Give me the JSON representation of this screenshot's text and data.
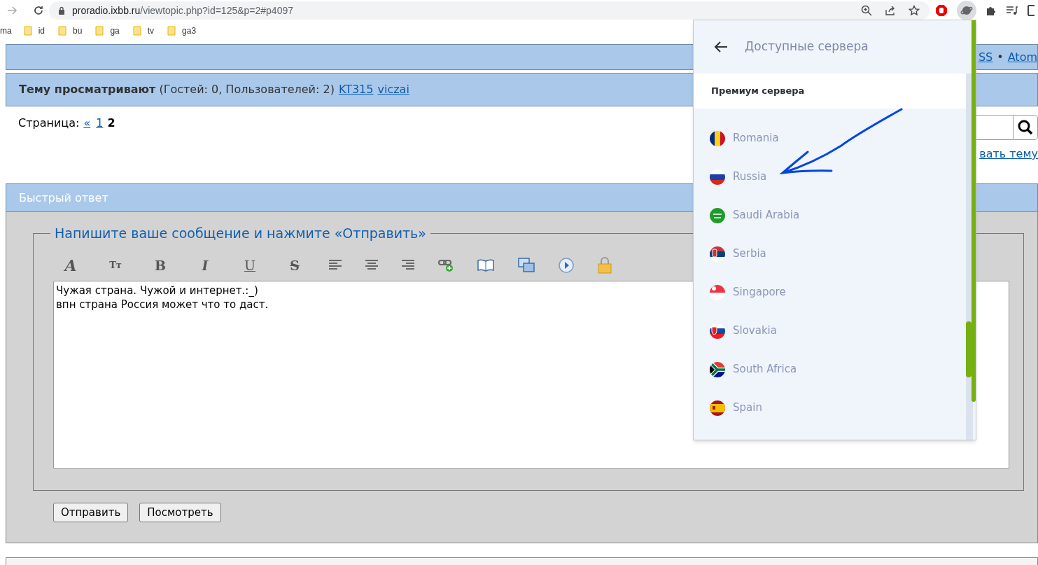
{
  "browser": {
    "url_host": "proradio.ixbb.ru",
    "url_path": "/viewtopic.php?id=125&p=2#p4097"
  },
  "bookmarks": [
    {
      "label": "ma",
      "kind": "cut"
    },
    {
      "label": "id",
      "kind": "folder"
    },
    {
      "label": "bu",
      "kind": "folder"
    },
    {
      "label": "ga",
      "kind": "folder"
    },
    {
      "label": "tv",
      "kind": "folder"
    },
    {
      "label": "ga3",
      "kind": "folder"
    }
  ],
  "header_links": [
    "SS",
    "Atom"
  ],
  "header_separator": "•",
  "viewers": {
    "title": "Тему просматривают",
    "counts": "(Гостей: 0, Пользователей: 2)",
    "users": [
      "KT315",
      "viczai"
    ]
  },
  "pagination": {
    "label": "Страница:",
    "prev": "«",
    "pages": [
      {
        "label": "1",
        "selected": false
      },
      {
        "label": "2",
        "selected": true
      }
    ]
  },
  "new_topic_link": "вать тему",
  "quick_reply": {
    "title": "Быстрый ответ",
    "legend": "Напишите ваше сообщение и нажмите «Отправить»",
    "toolbar": [
      {
        "kind": "font-color",
        "label": "A"
      },
      {
        "kind": "font-size",
        "label": "Tт"
      },
      {
        "kind": "bold",
        "label": "B"
      },
      {
        "kind": "italic",
        "label": "I"
      },
      {
        "kind": "underline",
        "label": "U"
      },
      {
        "kind": "strike",
        "label": "S"
      },
      {
        "kind": "align-left"
      },
      {
        "kind": "align-center"
      },
      {
        "kind": "align-right"
      },
      {
        "kind": "link"
      },
      {
        "kind": "book"
      },
      {
        "kind": "windows"
      },
      {
        "kind": "play"
      },
      {
        "kind": "lock"
      }
    ],
    "message": "Чужая страна. Чужой и интернет.:_)\nвпн страна Россия может что то даст.",
    "buttons": [
      "Отправить",
      "Посмотреть"
    ]
  },
  "vpn_popup": {
    "title": "Доступные сервера",
    "section": "Премиум сервера",
    "servers": [
      "Romania",
      "Russia",
      "Saudi Arabia",
      "Serbia",
      "Singapore",
      "Slovakia",
      "South Africa",
      "Spain"
    ]
  }
}
